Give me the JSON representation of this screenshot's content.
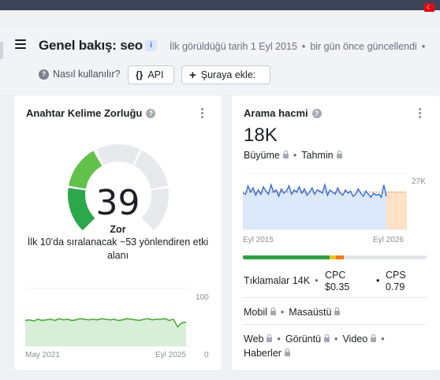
{
  "header": {
    "title": "Genel bakış: seo",
    "badge": "i",
    "first_seen": "İlk görüldüğü tarih 1 Eyl 2015",
    "updated": "bir gün önce güncellendi",
    "help_label": "Nasıl kullanılır?",
    "api_label": "API",
    "add_label": "Şuraya ekle:"
  },
  "kd_card": {
    "title": "Anahtar Kelime Zorluğu",
    "value": "39",
    "level": "Zor",
    "description": "İlk 10'da sıralanacak ~53 yönlendiren etki alanı",
    "axis_max": "100",
    "axis_min": "0",
    "x_start": "May 2021",
    "x_end": "Eyl 2025",
    "gauge_fraction": 0.39,
    "colors": {
      "green_dark": "#2aa84a",
      "green": "#62c14a",
      "lime": "#a7cc1c",
      "track": "#e8e9ec"
    }
  },
  "sv_card": {
    "title": "Arama hacmi",
    "value": "18K",
    "growth_label": "Büyüme",
    "forecast_label": "Tahmin",
    "axis_max": "27K",
    "x_start": "Eyl 2015",
    "x_end": "Eyl 2026",
    "intent_colors": [
      "#2ea043",
      "#f0c419",
      "#f07a1a"
    ],
    "clicks_label": "Tıklamalar 14K",
    "cpc_label": "CPC",
    "cpc_value": "$0.35",
    "cps_label": "CPS",
    "cps_value": "0.79",
    "mobile_label": "Mobil",
    "desktop_label": "Masaüstü",
    "serp": [
      "Web",
      "Görüntü",
      "Video",
      "Haberler"
    ]
  },
  "chart_data": [
    {
      "type": "area",
      "title": "Anahtar Kelime Zorluğu",
      "x_range": [
        "May 2021",
        "Eyl 2025"
      ],
      "ylim": [
        0,
        100
      ],
      "values": [
        44,
        45,
        43,
        46,
        44,
        45,
        46,
        44,
        47,
        45,
        46,
        44,
        45,
        47,
        46,
        45,
        46,
        45,
        47,
        46,
        45,
        46,
        44,
        45,
        47,
        46,
        45,
        44,
        46,
        47,
        45,
        46,
        46,
        47,
        44,
        46,
        33,
        40,
        41
      ]
    },
    {
      "type": "line",
      "title": "Arama hacmi",
      "x_range": [
        "Eyl 2015",
        "Eyl 2026"
      ],
      "ylim": [
        0,
        27000
      ],
      "values": [
        17500,
        17000,
        21000,
        18000,
        20000,
        16500,
        19000,
        17000,
        20500,
        18500,
        17000,
        21500,
        18000,
        19000,
        16000,
        19500,
        17500,
        18500,
        21000,
        17000,
        19000,
        18000,
        20500,
        17500,
        19500,
        16500,
        18000,
        20000,
        17000,
        19000,
        18500,
        17500,
        21500,
        16500,
        19000,
        18000,
        17000,
        20000,
        17500,
        16500,
        19000,
        17500,
        18500,
        16000,
        17000,
        19500,
        17500,
        16000,
        18500,
        17000,
        15500,
        17500,
        16500,
        17000,
        15500,
        21500,
        16000
      ],
      "forecast": [
        17500,
        18500,
        17800,
        18200
      ]
    }
  ]
}
